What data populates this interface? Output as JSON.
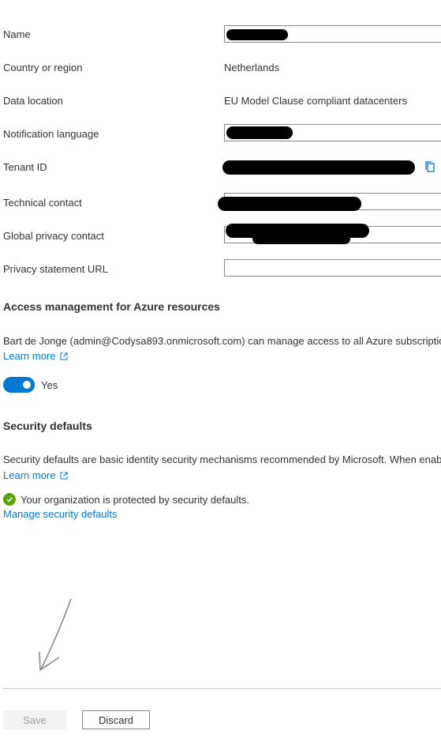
{
  "fields": [
    {
      "label": "Name",
      "value": ""
    },
    {
      "label": "Country or region",
      "value": "Netherlands"
    },
    {
      "label": "Data location",
      "value": "EU Model Clause compliant datacenters"
    },
    {
      "label": "Notification language",
      "value": ""
    },
    {
      "label": "Tenant ID",
      "value": ""
    },
    {
      "label": "Technical contact",
      "value": ""
    },
    {
      "label": "Global privacy contact",
      "value": ""
    },
    {
      "label": "Privacy statement URL",
      "value": ""
    }
  ],
  "access": {
    "title": "Access management for Azure resources",
    "description": "Bart de Jonge (admin@Codysa893.onmicrosoft.com) can manage access to all Azure subscriptio",
    "learn_more": "Learn more",
    "toggle_label": "Yes",
    "toggle_on": true
  },
  "security": {
    "title": "Security defaults",
    "description": "Security defaults are basic identity security mechanisms recommended by Microsoft. When enab",
    "learn_more": "Learn more",
    "status": "Your organization is protected by security defaults.",
    "manage_link": "Manage security defaults"
  },
  "footer": {
    "save_label": "Save",
    "discard_label": "Discard"
  },
  "colors": {
    "accent": "#0078d4",
    "success": "#57a300"
  }
}
